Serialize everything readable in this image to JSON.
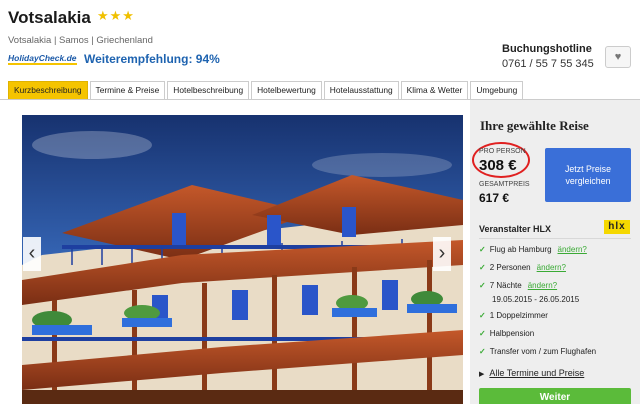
{
  "hotel": {
    "name": "Votsalakia",
    "stars": "★★★",
    "location": "Votsalakia | Samos | Griechenland",
    "holidaycheck_logo": "HolidayCheck.de",
    "recommendation": "Weiterempfehlung:  94%"
  },
  "hotline": {
    "title": "Buchungshotline",
    "phone": "0761 / 55 7 55 345"
  },
  "favorite_icon": "♥",
  "tabs": [
    {
      "label": "Kurzbeschreibung",
      "active": true
    },
    {
      "label": "Termine & Preise",
      "active": false
    },
    {
      "label": "Hotelbeschreibung",
      "active": false
    },
    {
      "label": "Hotelbewertung",
      "active": false
    },
    {
      "label": "Hotelausstattung",
      "active": false
    },
    {
      "label": "Klima & Wetter",
      "active": false
    },
    {
      "label": "Umgebung",
      "active": false
    }
  ],
  "gallery": {
    "prev_icon": "‹",
    "next_icon": "›"
  },
  "booking": {
    "title": "Ihre gewählte Reise",
    "pro_person_label": "PRO PERSON",
    "price_per_person": "308 €",
    "total_label": "GESAMTPREIS",
    "total_price": "617 €",
    "compare_button": "Jetzt Preise vergleichen",
    "operator": "Veranstalter HLX",
    "operator_logo": "hlx",
    "features": [
      {
        "text": "Flug ab Hamburg",
        "change": "ändern?"
      },
      {
        "text": "2 Personen",
        "change": "ändern?"
      },
      {
        "text": "7 Nächte",
        "change": "ändern?"
      },
      {
        "text": "1 Doppelzimmer",
        "change": ""
      },
      {
        "text": "Halbpension",
        "change": ""
      },
      {
        "text": "Transfer vom / zum Flughafen",
        "change": ""
      }
    ],
    "dates": "19.05.2015 - 26.05.2015",
    "all_dates_link": "Alle Termine und Preise",
    "primary_button": "Weiter"
  },
  "colors": {
    "accent_yellow": "#f5c400",
    "link_blue": "#1e63b0",
    "button_blue": "#3a6fd8",
    "check_green": "#3aaa35",
    "highlight_red": "#e02020"
  }
}
